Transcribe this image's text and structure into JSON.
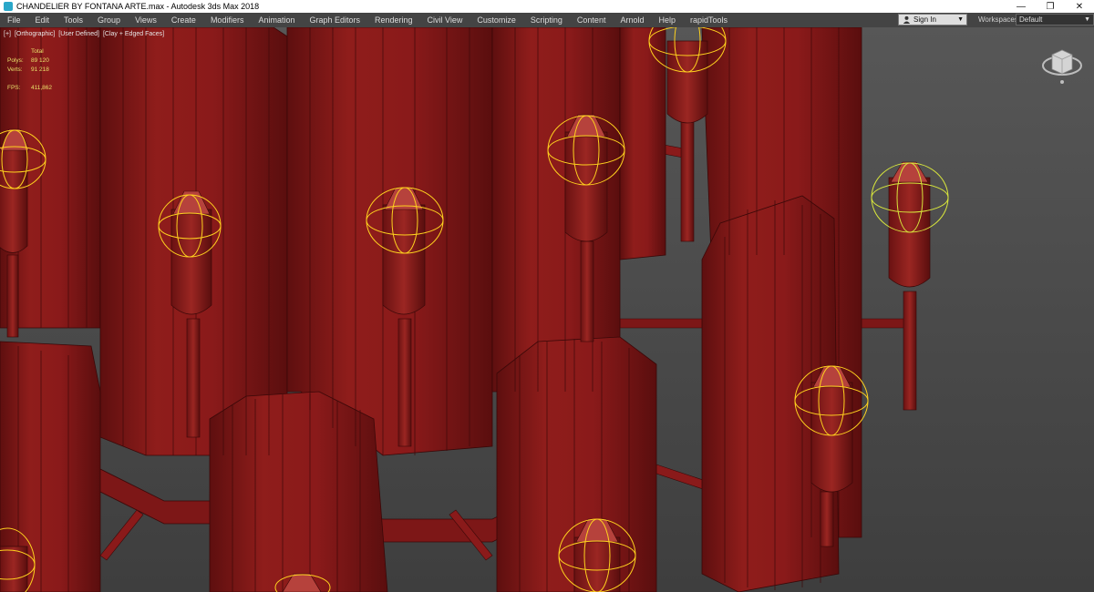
{
  "window": {
    "title": "CHANDELIER BY FONTANA ARTE.max - Autodesk 3ds Max 2018",
    "buttons": {
      "minimize": "—",
      "maximize": "❐",
      "close": "✕"
    }
  },
  "menu": [
    "File",
    "Edit",
    "Tools",
    "Group",
    "Views",
    "Create",
    "Modifiers",
    "Animation",
    "Graph Editors",
    "Rendering",
    "Civil View",
    "Customize",
    "Scripting",
    "Content",
    "Arnold",
    "Help",
    "rapidTools"
  ],
  "account": {
    "sign_in": "Sign In",
    "workspaces_label": "Workspaces:",
    "workspace_value": "Default"
  },
  "viewport": {
    "label": {
      "plus": "[+]",
      "view": "[Orthographic]",
      "camera": "[User Defined]",
      "shading": "[Clay + Edged Faces]"
    },
    "stats": {
      "total_label": "Total",
      "polys_label": "Polys:",
      "polys_value": "89 120",
      "verts_label": "Verts:",
      "verts_value": "91 218",
      "fps_label": "FPS:",
      "fps_value": "411,862"
    }
  },
  "colors": {
    "object": "#8b1a1a",
    "object_dark": "#5e0f0f",
    "object_light": "#a8332c",
    "selection": "#ffd21e",
    "viewport_bg": "#4b4b4b"
  }
}
